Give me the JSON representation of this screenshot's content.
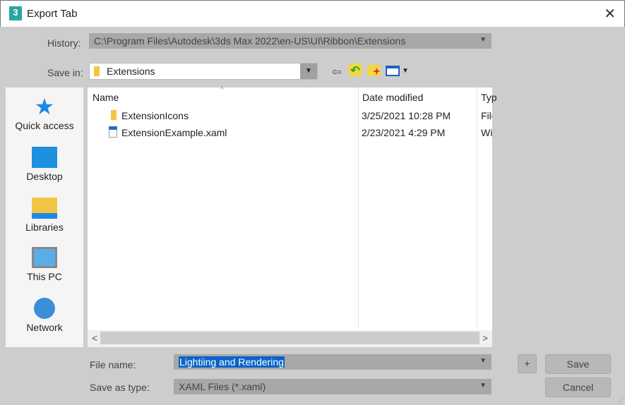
{
  "window": {
    "title": "Export Tab",
    "app_icon": "3"
  },
  "history": {
    "label": "History:",
    "value": "C:\\Program Files\\Autodesk\\3ds Max 2022\\en-US\\UI\\Ribbon\\Extensions"
  },
  "save_in": {
    "label": "Save in:",
    "value": "Extensions"
  },
  "places": [
    {
      "label": "Quick access"
    },
    {
      "label": "Desktop"
    },
    {
      "label": "Libraries"
    },
    {
      "label": "This PC"
    },
    {
      "label": "Network"
    }
  ],
  "columns": {
    "name": "Name",
    "date": "Date modified",
    "type": "Typ"
  },
  "files": [
    {
      "name": "ExtensionIcons",
      "date": "3/25/2021 10:28 PM",
      "type": "File"
    },
    {
      "name": "ExtensionExample.xaml",
      "date": "2/23/2021 4:29 PM",
      "type": "Wi"
    }
  ],
  "file_name": {
    "label": "File name:",
    "value": "Lightiing and Rendering"
  },
  "save_type": {
    "label": "Save as type:",
    "value": "XAML Files (*.xaml)"
  },
  "buttons": {
    "plus": "+",
    "save": "Save",
    "cancel": "Cancel"
  }
}
